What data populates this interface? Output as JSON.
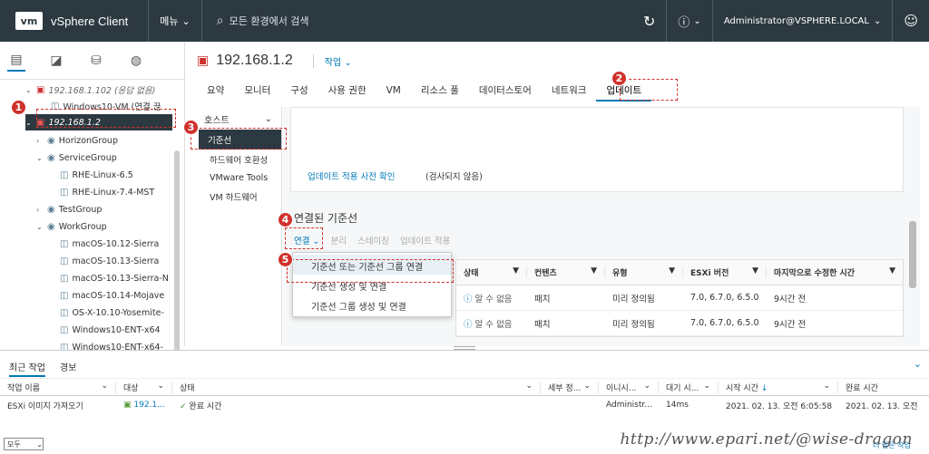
{
  "topbar": {
    "logo": "vm",
    "app_title": "vSphere Client",
    "menu_label": "메뉴",
    "search_placeholder": "모든 환경에서 검색",
    "user": "Administrator@VSPHERE.LOCAL"
  },
  "tree": {
    "items": [
      {
        "label": "192.168.1.102 (응답 없음)"
      },
      {
        "label": "Windows10-VM (연결 끊"
      },
      {
        "label": "192.168.1.2"
      },
      {
        "label": "HorizonGroup"
      },
      {
        "label": "ServiceGroup"
      },
      {
        "label": "RHE-Linux-6.5"
      },
      {
        "label": "RHE-Linux-7.4-MST"
      },
      {
        "label": "TestGroup"
      },
      {
        "label": "WorkGroup"
      },
      {
        "label": "macOS-10.12-Sierra"
      },
      {
        "label": "macOS-10.13-Sierra"
      },
      {
        "label": "macOS-10.13-Sierra-N"
      },
      {
        "label": "macOS-10.14-Mojave"
      },
      {
        "label": "OS-X-10.10-Yosemite-"
      },
      {
        "label": "Windows10-ENT-x64"
      },
      {
        "label": "Windows10-ENT-x64-"
      }
    ]
  },
  "object": {
    "name": "192.168.1.2",
    "actions_label": "작업",
    "tabs": [
      "요약",
      "모니터",
      "구성",
      "사용 권한",
      "VM",
      "리소스 풀",
      "데이터스토어",
      "네트워크",
      "업데이트"
    ]
  },
  "subnav": {
    "header": "호스트",
    "items": [
      "기준선",
      "하드웨어 호환성",
      "VMware Tools",
      "VM 하드웨어"
    ]
  },
  "content": {
    "precheck_link": "업데이트 적용 사전 확인",
    "precheck_note": "(검사되지 않음)",
    "section_title": "연결된 기준선",
    "actions": {
      "attach": "연결",
      "detach": "분리",
      "stage": "스테이징",
      "remediate": "업데이트 적용"
    },
    "columns": [
      "상태",
      "컨텐츠",
      "유형",
      "ESXi 버전",
      "마지막으로 수정한 시간"
    ],
    "rows": [
      [
        "알 수 없음",
        "패치",
        "미리 정의됨",
        "7.0, 6.7.0, 6.5.0",
        "9시간 전"
      ],
      [
        "알 수 없음",
        "패치",
        "미리 정의됨",
        "7.0, 6.7.0, 6.5.0",
        "9시간 전"
      ]
    ]
  },
  "dropdown": {
    "options": [
      "기준선 또는 기준선 그룹 연결",
      "기준선 생성 및 연결",
      "기준선 그룹 생성 및 연결"
    ]
  },
  "annotations": [
    "1",
    "2",
    "3",
    "4",
    "5"
  ],
  "bottom": {
    "tabs": [
      "최근 작업",
      "경보"
    ],
    "columns": [
      "작업 이름",
      "대상",
      "상태",
      "세부 정...",
      "이니시...",
      "대기 시...",
      "시작 시간",
      "완료 시간"
    ],
    "task": {
      "name": "ESXi 이미지 가져오기",
      "target": "192.1...",
      "status": "완료 시간",
      "initiator": "Administr...",
      "wait": "14ms",
      "start": "2021. 02. 13. 오전 6:05:58",
      "end": "2021. 02. 13. 오전"
    },
    "filter_value": "모두",
    "footer_link": "더 많은 작업",
    "watermark": "http://www.epari.net/@wise-dragon"
  },
  "colors": {
    "accent": "#0079b8",
    "header_bg": "#2d3941",
    "annotation": "#d0312d"
  }
}
